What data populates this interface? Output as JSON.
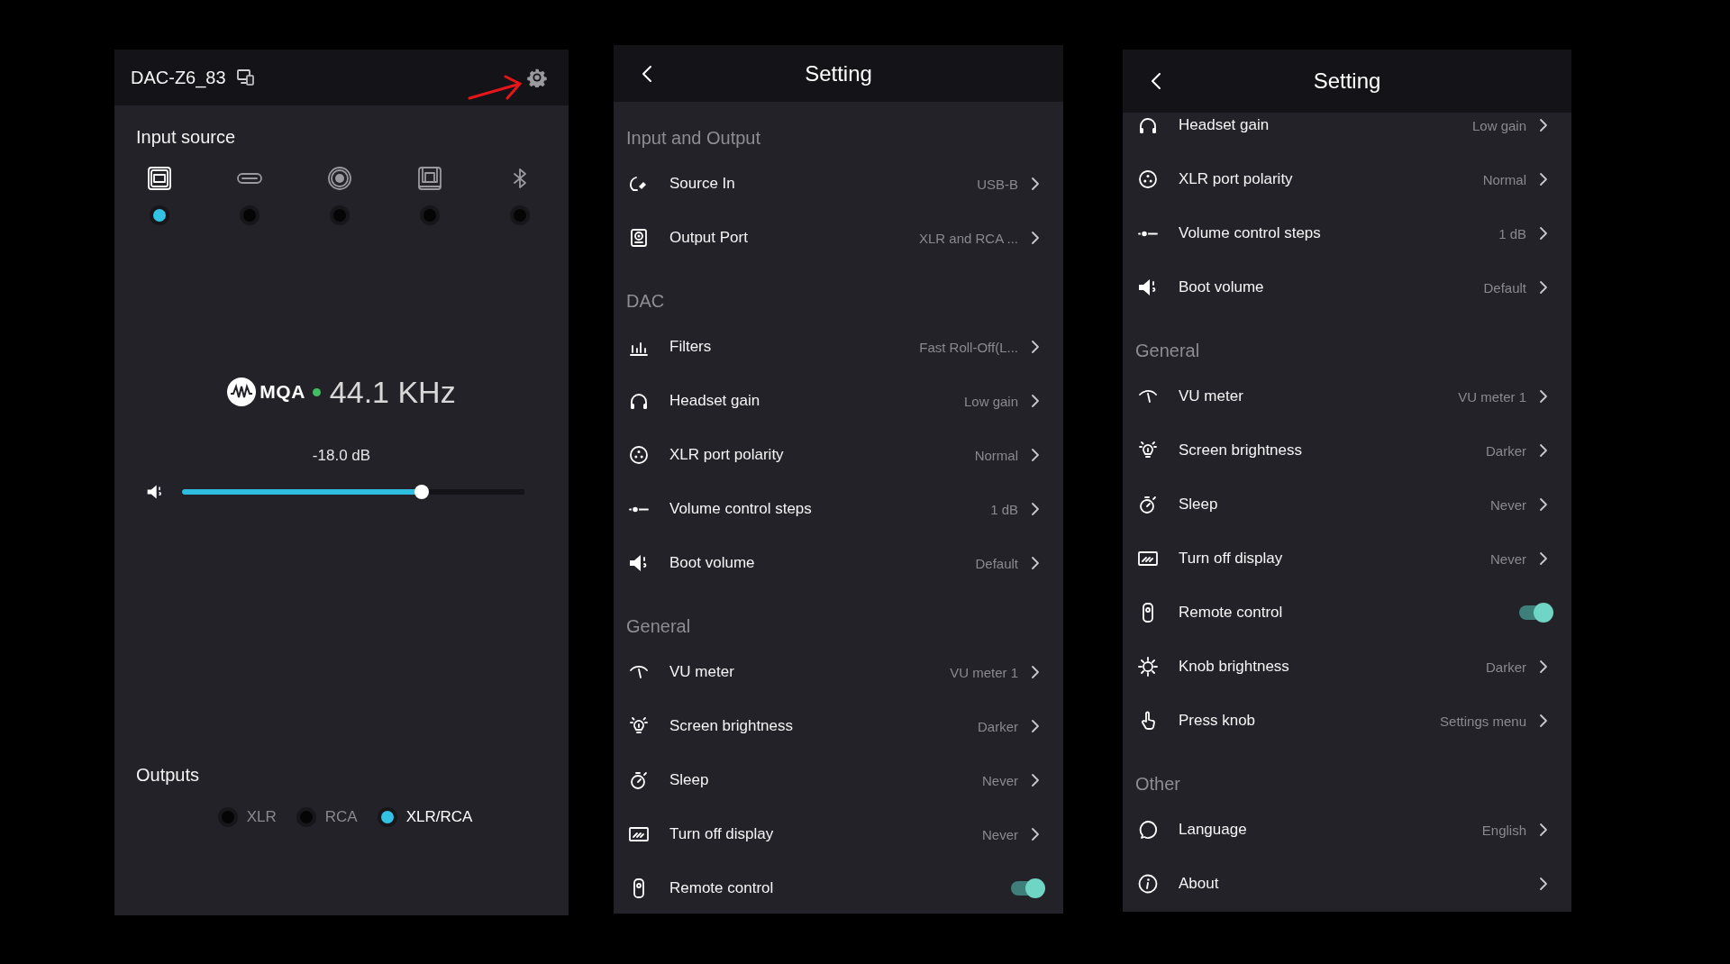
{
  "device_panel": {
    "title": "DAC-Z6_83",
    "input_source": {
      "label": "Input source",
      "options": [
        {
          "kind": "usb-b",
          "selected": true
        },
        {
          "kind": "usb-c",
          "selected": false
        },
        {
          "kind": "coaxial",
          "selected": false
        },
        {
          "kind": "optical",
          "selected": false
        },
        {
          "kind": "bluetooth",
          "selected": false
        }
      ]
    },
    "format": {
      "badge": "MQA",
      "sample_rate": "44.1 KHz"
    },
    "volume": {
      "reading": "-18.0 dB",
      "level": 0.7
    },
    "outputs": {
      "label": "Outputs",
      "options": [
        {
          "label": "XLR",
          "selected": false
        },
        {
          "label": "RCA",
          "selected": false
        },
        {
          "label": "XLR/RCA",
          "selected": true
        }
      ]
    }
  },
  "settings_screens": [
    {
      "title": "Setting",
      "sections": [
        {
          "title": "Input and Output",
          "items": [
            {
              "kind": "link",
              "label": "Source In",
              "value": "USB-B"
            },
            {
              "kind": "link",
              "label": "Output Port",
              "value": "XLR and RCA ..."
            }
          ]
        },
        {
          "title": "DAC",
          "items": [
            {
              "kind": "link",
              "label": "Filters",
              "value": "Fast Roll-Off(L..."
            },
            {
              "kind": "link",
              "label": "Headset gain",
              "value": "Low gain"
            },
            {
              "kind": "link",
              "label": "XLR port polarity",
              "value": "Normal"
            },
            {
              "kind": "link",
              "label": "Volume control steps",
              "value": "1 dB"
            },
            {
              "kind": "link",
              "label": "Boot volume",
              "value": "Default"
            }
          ]
        },
        {
          "title": "General",
          "items": [
            {
              "kind": "link",
              "label": "VU meter",
              "value": "VU meter 1"
            },
            {
              "kind": "link",
              "label": "Screen brightness",
              "value": "Darker"
            },
            {
              "kind": "link",
              "label": "Sleep",
              "value": "Never"
            },
            {
              "kind": "link",
              "label": "Turn off display",
              "value": "Never"
            },
            {
              "kind": "toggle",
              "label": "Remote control",
              "on": true
            }
          ]
        }
      ]
    },
    {
      "title": "Setting",
      "sections": [
        {
          "items": [
            {
              "kind": "link",
              "label": "Headset gain",
              "value": "Low gain"
            },
            {
              "kind": "link",
              "label": "XLR port polarity",
              "value": "Normal"
            },
            {
              "kind": "link",
              "label": "Volume control steps",
              "value": "1 dB"
            },
            {
              "kind": "link",
              "label": "Boot volume",
              "value": "Default"
            }
          ]
        },
        {
          "title": "General",
          "items": [
            {
              "kind": "link",
              "label": "VU meter",
              "value": "VU meter 1"
            },
            {
              "kind": "link",
              "label": "Screen brightness",
              "value": "Darker"
            },
            {
              "kind": "link",
              "label": "Sleep",
              "value": "Never"
            },
            {
              "kind": "link",
              "label": "Turn off display",
              "value": "Never"
            },
            {
              "kind": "toggle",
              "label": "Remote control",
              "on": true
            },
            {
              "kind": "link",
              "label": "Knob brightness",
              "value": "Darker"
            },
            {
              "kind": "link",
              "label": "Press knob",
              "value": "Settings menu"
            }
          ]
        },
        {
          "title": "Other",
          "items": [
            {
              "kind": "link",
              "label": "Language",
              "value": "English"
            },
            {
              "kind": "link",
              "label": "About"
            }
          ]
        }
      ]
    }
  ]
}
